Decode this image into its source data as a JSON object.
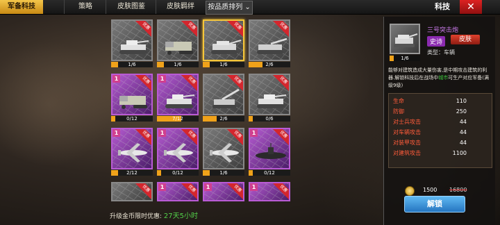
{
  "tabs": [
    {
      "label": "军备科技",
      "active": true
    },
    {
      "label": "策略",
      "active": false
    },
    {
      "label": "皮肤图鉴",
      "active": false
    },
    {
      "label": "皮肤羁绊",
      "active": false
    }
  ],
  "sort_label": "按品质排列",
  "title": "科技",
  "colors": {
    "accent": "#f0a21a",
    "rare": "#b95bd5",
    "common": "#888888",
    "badge": "#d3262d",
    "unlock": "#2575c0"
  },
  "badge_text": "优惠",
  "cards": [
    {
      "row": 0,
      "col": 0,
      "rare": false,
      "level": "",
      "badge": true,
      "unit": "tank",
      "progress": "1/6",
      "fill": 0.17,
      "selected": false
    },
    {
      "row": 0,
      "col": 1,
      "rare": false,
      "level": "",
      "badge": true,
      "unit": "halftrack",
      "progress": "1/6",
      "fill": 0.17,
      "selected": false
    },
    {
      "row": 0,
      "col": 2,
      "rare": false,
      "level": "",
      "badge": true,
      "unit": "assault-gun",
      "progress": "1/6",
      "fill": 0.17,
      "selected": true
    },
    {
      "row": 0,
      "col": 3,
      "rare": false,
      "level": "",
      "badge": true,
      "unit": "tank-destroyer",
      "progress": "2/6",
      "fill": 0.33,
      "selected": false
    },
    {
      "row": 1,
      "col": 0,
      "rare": true,
      "level": "1",
      "badge": true,
      "unit": "halftrack",
      "progress": "0/12",
      "fill": 0,
      "selected": false
    },
    {
      "row": 1,
      "col": 1,
      "rare": true,
      "level": "1",
      "badge": true,
      "unit": "tank",
      "progress": "7/12",
      "fill": 0.58,
      "selected": false
    },
    {
      "row": 1,
      "col": 2,
      "rare": false,
      "level": "",
      "badge": true,
      "unit": "artillery",
      "progress": "2/6",
      "fill": 0.33,
      "selected": false
    },
    {
      "row": 1,
      "col": 3,
      "rare": false,
      "level": "",
      "badge": true,
      "unit": "tank",
      "progress": "0/6",
      "fill": 0,
      "selected": false
    },
    {
      "row": 2,
      "col": 0,
      "rare": true,
      "level": "1",
      "badge": true,
      "unit": "plane",
      "progress": "2/12",
      "fill": 0.17,
      "selected": false
    },
    {
      "row": 2,
      "col": 1,
      "rare": true,
      "level": "1",
      "badge": true,
      "unit": "plane",
      "progress": "0/12",
      "fill": 0,
      "selected": false
    },
    {
      "row": 2,
      "col": 2,
      "rare": false,
      "level": "",
      "badge": true,
      "unit": "plane",
      "progress": "1/6",
      "fill": 0.17,
      "selected": false
    },
    {
      "row": 2,
      "col": 3,
      "rare": true,
      "level": "1",
      "badge": true,
      "unit": "submarine",
      "progress": "0/12",
      "fill": 0,
      "selected": false
    },
    {
      "row": 3,
      "col": 0,
      "rare": false,
      "level": "",
      "badge": true,
      "unit": "",
      "progress": "",
      "fill": 0,
      "selected": false
    },
    {
      "row": 3,
      "col": 1,
      "rare": true,
      "level": "1",
      "badge": true,
      "unit": "",
      "progress": "",
      "fill": 0,
      "selected": false
    },
    {
      "row": 3,
      "col": 2,
      "rare": true,
      "level": "1",
      "badge": true,
      "unit": "",
      "progress": "",
      "fill": 0,
      "selected": false
    },
    {
      "row": 3,
      "col": 3,
      "rare": true,
      "level": "1",
      "badge": true,
      "unit": "",
      "progress": "",
      "fill": 0,
      "selected": false
    }
  ],
  "detail": {
    "name": "三号突击炮",
    "rarity": "史诗",
    "skin_button": "皮肤",
    "type": "类型：车辆",
    "progress": "1/6",
    "desc_1": "能够对建筑造成大量伤害,是中期攻击建筑的利器.解锁科技后在战场中",
    "desc_green": "城市",
    "desc_2": "可生产对应军备(满级9级)",
    "stats": [
      {
        "label": "生命",
        "value": "110"
      },
      {
        "label": "防御",
        "value": "250"
      },
      {
        "label": "对士兵攻击",
        "value": "44"
      },
      {
        "label": "对车辆攻击",
        "value": "44"
      },
      {
        "label": "对装甲攻击",
        "value": "44"
      },
      {
        "label": "对建筑攻击",
        "value": "1100"
      }
    ],
    "price": "1500",
    "old_price": "16800",
    "unlock_label": "解锁"
  },
  "timer_label": "升级金币限时优惠:",
  "timer_value": "27天5小时"
}
